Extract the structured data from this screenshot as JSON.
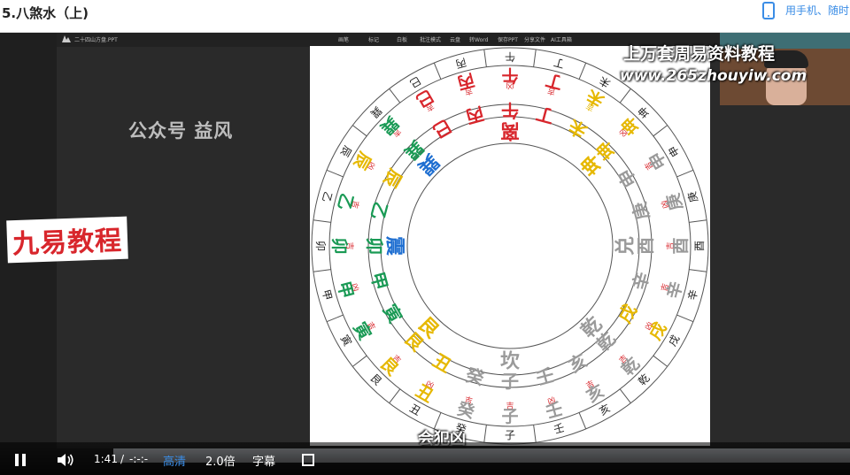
{
  "page": {
    "title": "5.八煞水（上)",
    "phone_link": "用手机、随时"
  },
  "watermarks": {
    "gongzhonghao": "公众号 益风",
    "jiuyi": "九易教程",
    "site_name": "上万套周易资料教程",
    "site_url": "www.265zhouyiw.com",
    "subtitle": "会犯凶"
  },
  "colors": {
    "red": "#d8262c",
    "yellow": "#e6b800",
    "blue": "#1f6fd1",
    "green": "#1a9a55",
    "gray": "#9a9a9a",
    "dark": "#222222",
    "accent": "#3b8de6"
  },
  "wheel": {
    "outer_ring": [
      {
        "t": "丙",
        "c": "dark"
      },
      {
        "t": "午",
        "c": "dark"
      },
      {
        "t": "丁",
        "c": "dark"
      },
      {
        "t": "未",
        "c": "dark"
      },
      {
        "t": "坤",
        "c": "dark"
      },
      {
        "t": "申",
        "c": "dark"
      },
      {
        "t": "庚",
        "c": "dark"
      },
      {
        "t": "酉",
        "c": "dark"
      },
      {
        "t": "辛",
        "c": "dark"
      },
      {
        "t": "戌",
        "c": "dark"
      },
      {
        "t": "乾",
        "c": "dark"
      },
      {
        "t": "亥",
        "c": "dark"
      },
      {
        "t": "壬",
        "c": "dark"
      },
      {
        "t": "子",
        "c": "dark"
      },
      {
        "t": "癸",
        "c": "dark"
      },
      {
        "t": "丑",
        "c": "dark"
      },
      {
        "t": "艮",
        "c": "dark"
      },
      {
        "t": "寅",
        "c": "dark"
      },
      {
        "t": "甲",
        "c": "dark"
      },
      {
        "t": "卯",
        "c": "dark"
      },
      {
        "t": "乙",
        "c": "dark"
      },
      {
        "t": "辰",
        "c": "dark"
      },
      {
        "t": "巽",
        "c": "dark"
      },
      {
        "t": "巳",
        "c": "dark"
      }
    ],
    "middle_ring": [
      {
        "t": "丙",
        "c": "red"
      },
      {
        "t": "午",
        "c": "red"
      },
      {
        "t": "丁",
        "c": "red"
      },
      {
        "t": "未",
        "c": "yellow"
      },
      {
        "t": "坤",
        "c": "yellow"
      },
      {
        "t": "申",
        "c": "gray"
      },
      {
        "t": "庚",
        "c": "gray"
      },
      {
        "t": "酉",
        "c": "gray"
      },
      {
        "t": "辛",
        "c": "gray"
      },
      {
        "t": "戌",
        "c": "yellow"
      },
      {
        "t": "乾",
        "c": "gray"
      },
      {
        "t": "亥",
        "c": "gray"
      },
      {
        "t": "壬",
        "c": "gray"
      },
      {
        "t": "子",
        "c": "gray"
      },
      {
        "t": "癸",
        "c": "gray"
      },
      {
        "t": "丑",
        "c": "yellow"
      },
      {
        "t": "艮",
        "c": "yellow"
      },
      {
        "t": "寅",
        "c": "green"
      },
      {
        "t": "甲",
        "c": "green"
      },
      {
        "t": "卯",
        "c": "green"
      },
      {
        "t": "乙",
        "c": "green"
      },
      {
        "t": "辰",
        "c": "yellow"
      },
      {
        "t": "巽",
        "c": "green"
      },
      {
        "t": "巳",
        "c": "red"
      }
    ],
    "marks_ring": [
      {
        "t": "吉",
        "c": "red"
      },
      {
        "t": "凶",
        "c": "red"
      },
      {
        "t": "吉",
        "c": "red"
      },
      {
        "t": "吉",
        "c": "yellow"
      },
      {
        "t": "凶",
        "c": "red"
      },
      {
        "t": "吉",
        "c": "red"
      },
      {
        "t": "凶",
        "c": "red"
      },
      {
        "t": "吉",
        "c": "red"
      },
      {
        "t": "吉",
        "c": "red"
      },
      {
        "t": "凶",
        "c": "red"
      },
      {
        "t": "吉",
        "c": "red"
      },
      {
        "t": "吉",
        "c": "red"
      },
      {
        "t": "凶",
        "c": "red"
      },
      {
        "t": "吉",
        "c": "red"
      },
      {
        "t": "吉",
        "c": "red"
      },
      {
        "t": "凶",
        "c": "red"
      },
      {
        "t": "吉",
        "c": "red"
      },
      {
        "t": "吉",
        "c": "red"
      },
      {
        "t": "凶",
        "c": "red"
      },
      {
        "t": "吉",
        "c": "red"
      },
      {
        "t": "吉",
        "c": "red"
      },
      {
        "t": "凶",
        "c": "red"
      },
      {
        "t": "吉",
        "c": "red"
      },
      {
        "t": "吉",
        "c": "red"
      }
    ],
    "trigrams": [
      {
        "t": "离",
        "c": "red"
      },
      {
        "t": "坤",
        "c": "yellow"
      },
      {
        "t": "兑",
        "c": "gray"
      },
      {
        "t": "乾",
        "c": "gray"
      },
      {
        "t": "坎",
        "c": "gray"
      },
      {
        "t": "艮",
        "c": "yellow"
      },
      {
        "t": "震",
        "c": "blue"
      },
      {
        "t": "巽",
        "c": "blue"
      }
    ]
  },
  "app": {
    "title": "二十四山方盘.PPT",
    "toolbar": [
      "画笔",
      "标记",
      "白板",
      "批注模式",
      "云盘",
      "转Word",
      "保存PPT",
      "分享文件",
      "AI工具箱"
    ]
  },
  "player": {
    "time_current": "1:41",
    "time_sep": "/",
    "time_total": "-:-:-",
    "quality": "高清",
    "speed": "2.0倍",
    "captions": "字幕"
  }
}
